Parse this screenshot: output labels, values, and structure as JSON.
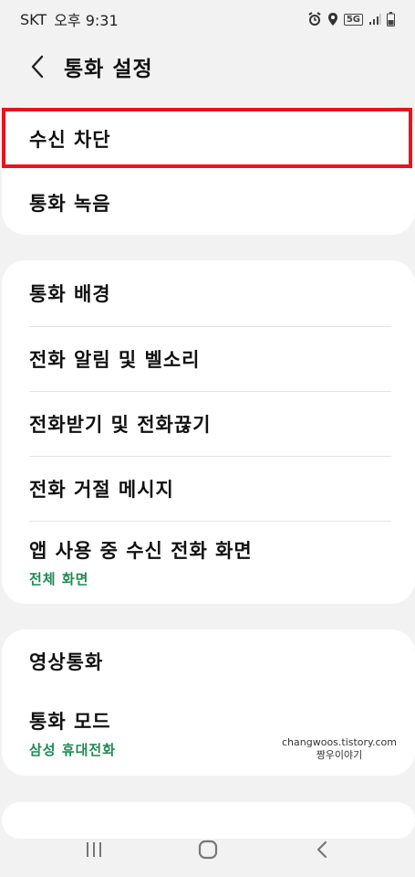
{
  "status_bar": {
    "carrier": "SKT",
    "time": "오후 9:31",
    "network": "5G"
  },
  "header": {
    "title": "통화 설정"
  },
  "groups": [
    {
      "items": [
        {
          "label": "수신 차단"
        },
        {
          "label": "통화 녹음"
        }
      ]
    },
    {
      "items": [
        {
          "label": "통화 배경"
        },
        {
          "label": "전화 알림 및 벨소리"
        },
        {
          "label": "전화받기 및 전화끊기"
        },
        {
          "label": "전화 거절 메시지"
        },
        {
          "label": "앱 사용 중 수신 전화 화면",
          "sub": "전체 화면"
        }
      ]
    },
    {
      "items": [
        {
          "label": "영상통화"
        },
        {
          "label": "통화 모드",
          "sub": "삼성 휴대전화"
        }
      ]
    }
  ],
  "watermark": {
    "line1": "changwoos.tistory.com",
    "line2": "짱우이야기"
  },
  "colors": {
    "highlight": "#e8141c",
    "sub_text": "#1f8a52",
    "background": "#f2f2f2"
  }
}
